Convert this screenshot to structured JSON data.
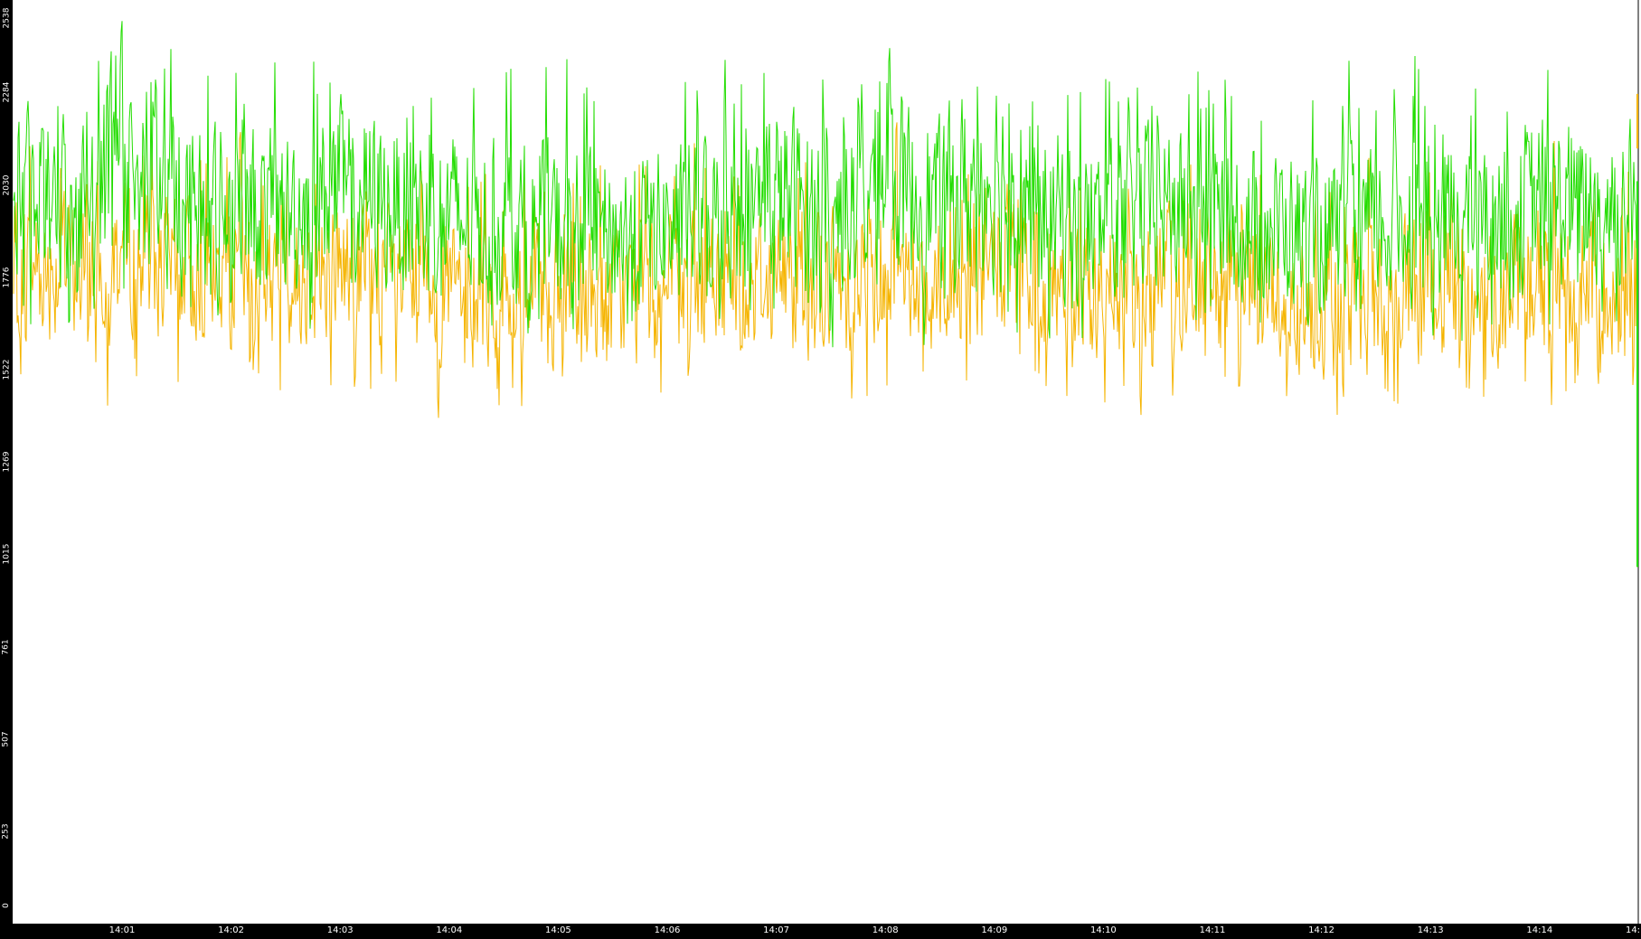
{
  "chart_data": {
    "type": "line",
    "title": "",
    "xlabel": "",
    "ylabel": "",
    "ylim": [
      0,
      2538
    ],
    "xlim": [
      "14:00:00",
      "14:14:00"
    ],
    "yticks": [
      "0",
      "253",
      "507",
      "761",
      "1015",
      "1269",
      "1522",
      "1776",
      "2030",
      "2284",
      "2538"
    ],
    "xticks": [
      "14:01",
      "14:02",
      "14:03",
      "14:04",
      "14:05",
      "14:06",
      "14:07",
      "14:08",
      "14:09",
      "14:10",
      "14:11",
      "14:12",
      "14:13",
      "14:14",
      "14:"
    ],
    "grid": false,
    "legend": "none",
    "series": [
      {
        "color": "#22dd00",
        "x": [
          "14:00:00",
          "14:00:30",
          "14:01:00",
          "14:01:30",
          "14:02:00",
          "14:02:30",
          "14:03:00",
          "14:03:30",
          "14:04:00",
          "14:04:30",
          "14:05:00",
          "14:05:30",
          "14:06:00",
          "14:06:30",
          "14:07:00",
          "14:07:30",
          "14:08:00",
          "14:08:30",
          "14:09:00",
          "14:09:30",
          "14:10:00",
          "14:10:30",
          "14:11:00",
          "14:11:30",
          "14:12:00",
          "14:12:30",
          "14:13:00",
          "14:13:30",
          "14:14:00"
        ],
        "values": [
          1990,
          2020,
          2080,
          2000,
          1980,
          1960,
          2010,
          1970,
          1950,
          1920,
          1900,
          1930,
          1940,
          1960,
          1990,
          1970,
          2000,
          1970,
          1990,
          1960,
          1920,
          1980,
          1970,
          1950,
          1910,
          1930,
          1960,
          1940,
          1980
        ],
        "envelope": {
          "low": [
            1720,
            1700,
            1740,
            1700,
            1690,
            1680,
            1720,
            1680,
            1660,
            1640,
            1620,
            1640,
            1650,
            1680,
            1700,
            1680,
            1720,
            1690,
            1700,
            1680,
            1640,
            1690,
            1680,
            1660,
            1630,
            1640,
            1670,
            1660,
            1690
          ],
          "high": [
            2320,
            2280,
            2490,
            2300,
            2250,
            2220,
            2320,
            2250,
            2220,
            2180,
            2200,
            2150,
            2180,
            2230,
            2310,
            2220,
            2350,
            2260,
            2430,
            2230,
            2180,
            2260,
            2210,
            2180,
            2140,
            2180,
            2240,
            2200,
            2270
          ],
          "min": 1540,
          "max": 2490
        }
      },
      {
        "color": "#f5b400",
        "x": [
          "14:00:00",
          "14:00:30",
          "14:01:00",
          "14:01:30",
          "14:02:00",
          "14:02:30",
          "14:03:00",
          "14:03:30",
          "14:04:00",
          "14:04:30",
          "14:05:00",
          "14:05:30",
          "14:06:00",
          "14:06:30",
          "14:07:00",
          "14:07:30",
          "14:08:00",
          "14:08:30",
          "14:09:00",
          "14:09:30",
          "14:10:00",
          "14:10:30",
          "14:11:00",
          "14:11:30",
          "14:12:00",
          "14:12:30",
          "14:13:00",
          "14:13:30",
          "14:14:00"
        ],
        "values": [
          1820,
          1840,
          1870,
          1820,
          1800,
          1790,
          1830,
          1790,
          1770,
          1740,
          1730,
          1750,
          1760,
          1780,
          1800,
          1780,
          1810,
          1780,
          1800,
          1770,
          1740,
          1790,
          1780,
          1760,
          1730,
          1740,
          1770,
          1760,
          1800
        ],
        "envelope": {
          "low": [
            1590,
            1560,
            1600,
            1560,
            1550,
            1540,
            1580,
            1540,
            1510,
            1480,
            1480,
            1490,
            1500,
            1520,
            1540,
            1500,
            1560,
            1520,
            1540,
            1520,
            1490,
            1530,
            1520,
            1500,
            1460,
            1480,
            1510,
            1500,
            1530
          ],
          "high": [
            2060,
            2040,
            2100,
            2030,
            2010,
            1990,
            2050,
            2000,
            1980,
            1950,
            1950,
            1960,
            1970,
            2000,
            2030,
            2000,
            2060,
            2010,
            2100,
            1990,
            1950,
            2010,
            1990,
            1970,
            1940,
            1960,
            2000,
            1980,
            2020
          ],
          "min": 1350,
          "max": 2260
        }
      }
    ]
  }
}
